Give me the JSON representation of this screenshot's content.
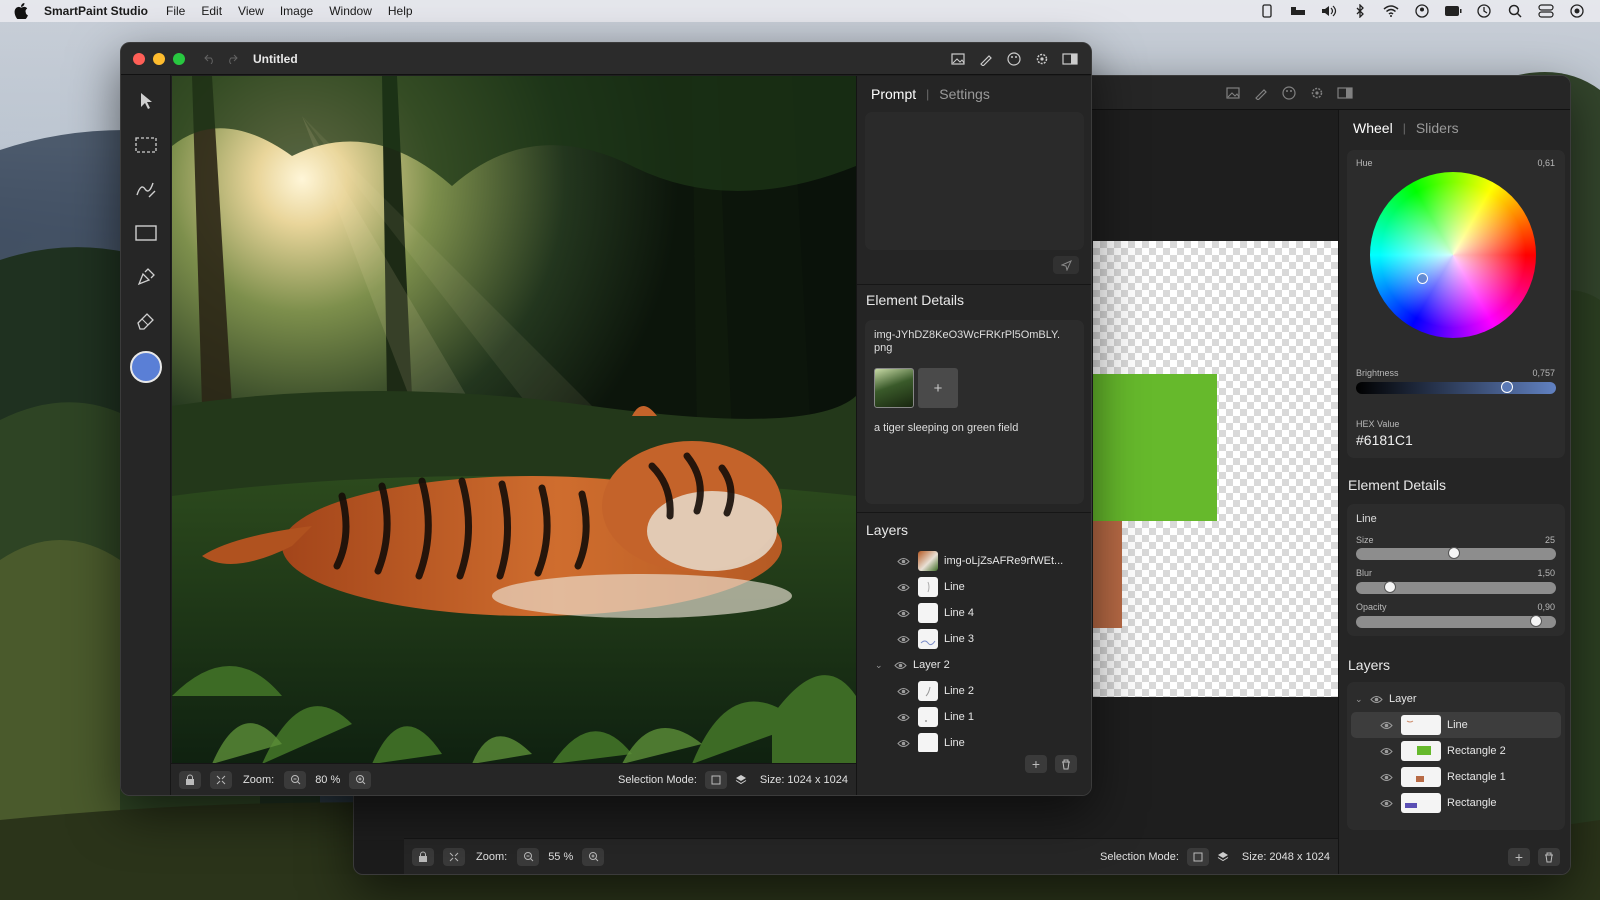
{
  "menubar": {
    "app_name": "SmartPaint Studio",
    "menus": [
      "File",
      "Edit",
      "View",
      "Image",
      "Window",
      "Help"
    ],
    "status_icons": [
      "phone-icon",
      "bed-icon",
      "volume-icon",
      "bluetooth-icon",
      "wifi-icon",
      "user-icon",
      "battery-icon",
      "clock-icon",
      "search-icon",
      "control-center-icon",
      "siri-icon"
    ]
  },
  "front_window": {
    "title": "Untitled",
    "tabs": {
      "prompt": "Prompt",
      "settings": "Settings"
    },
    "element_details": {
      "title": "Element Details",
      "filename": "img-JYhDZ8KeO3WcFRKrPl5OmBLY.png",
      "add_label": "+",
      "prompt_text": "a tiger sleeping on green field"
    },
    "layers": {
      "title": "Layers",
      "items": [
        {
          "label": "img-oLjZsAFRe9rfWEt...",
          "indent": 1,
          "thumb": "image"
        },
        {
          "label": "Line",
          "indent": 1,
          "thumb": "line"
        },
        {
          "label": "Line 4",
          "indent": 1,
          "thumb": "blank"
        },
        {
          "label": "Line 3",
          "indent": 1,
          "thumb": "scribble"
        },
        {
          "label": "Layer 2",
          "indent": 0,
          "thumb": "group"
        },
        {
          "label": "Line 2",
          "indent": 1,
          "thumb": "line"
        },
        {
          "label": "Line 1",
          "indent": 1,
          "thumb": "dot"
        },
        {
          "label": "Line",
          "indent": 1,
          "thumb": "blank"
        }
      ]
    },
    "bottom": {
      "zoom_label": "Zoom:",
      "zoom_value": "80 %",
      "selection_label": "Selection Mode:",
      "size_label": "Size: 1024 x 1024"
    },
    "accent_color": "#5a7fd6"
  },
  "back_window": {
    "tabs": {
      "wheel": "Wheel",
      "sliders": "Sliders"
    },
    "hue": {
      "label": "Hue",
      "value": "0,61"
    },
    "brightness": {
      "label": "Brightness",
      "value": "0,757",
      "level": 0.757
    },
    "hex": {
      "label": "HEX Value",
      "value": "#6181C1"
    },
    "element_details": {
      "title": "Element Details",
      "name": "Line",
      "size": {
        "label": "Size",
        "value": "25",
        "level": 0.49
      },
      "blur": {
        "label": "Blur",
        "value": "1,50",
        "level": 0.17
      },
      "opacity": {
        "label": "Opacity",
        "value": "0,90",
        "level": 0.9
      }
    },
    "layers": {
      "title": "Layers",
      "items": [
        {
          "label": "Layer",
          "indent": 0,
          "thumb": "group"
        },
        {
          "label": "Line",
          "indent": 1,
          "thumb": "line",
          "selected": true
        },
        {
          "label": "Rectangle 2",
          "indent": 1,
          "thumb": "green"
        },
        {
          "label": "Rectangle 1",
          "indent": 1,
          "thumb": "brown"
        },
        {
          "label": "Rectangle",
          "indent": 1,
          "thumb": "purple"
        }
      ]
    },
    "bottom": {
      "zoom_label": "Zoom:",
      "zoom_value": "55 %",
      "selection_label": "Selection Mode:",
      "size_label": "Size: 2048 x 1024"
    },
    "colors": {
      "green_rect": "#66b92c",
      "brown_rect": "#b86a45"
    }
  }
}
